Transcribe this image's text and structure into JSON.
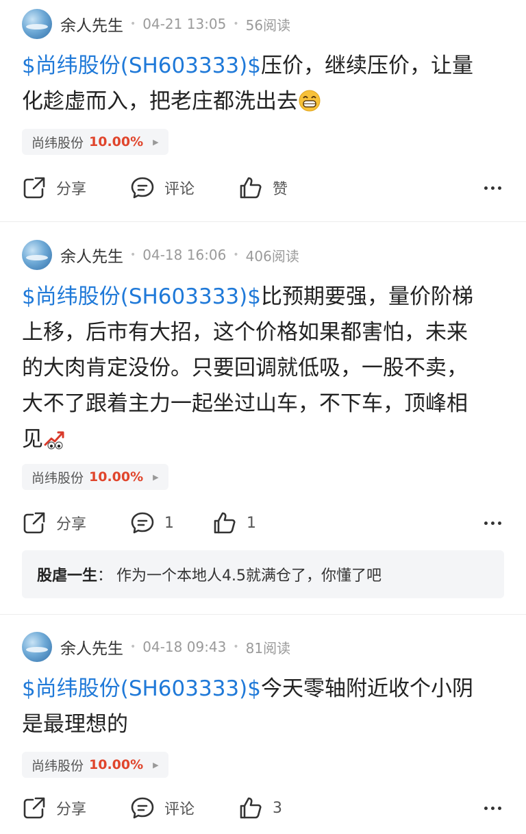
{
  "posts": [
    {
      "author": "余人先生",
      "time": "04-21 13:05",
      "reads": "56阅读",
      "stock_link": "$尚纬股份(SH603333)$",
      "lines": [
        "压价，继续压价，让量",
        "化趁虚而入，把老庄都洗出去"
      ],
      "emoji": "grin-emoji",
      "tag_name": "尚纬股份",
      "tag_pct": "10.00%",
      "share": "分享",
      "comment": "评论",
      "like": "赞"
    },
    {
      "author": "余人先生",
      "time": "04-18 16:06",
      "reads": "406阅读",
      "stock_link": "$尚纬股份(SH603333)$",
      "lines": [
        "比预期要强，量价阶梯",
        "上移，后市有大招，这个价格如果都害怕，未来",
        "的大肉肯定没份。只要回调就低吸，一股不卖，",
        "大不了跟着主力一起坐过山车，不下车，顶峰相",
        "见"
      ],
      "emoji": "chart-up-eyes-emoji",
      "tag_name": "尚纬股份",
      "tag_pct": "10.00%",
      "share": "分享",
      "comment": "1",
      "like": "1",
      "reply": {
        "user": "股虐一生",
        "sep": "：",
        "text": "作为一个本地人4.5就满仓了，你懂了吧"
      }
    },
    {
      "author": "余人先生",
      "time": "04-18 09:43",
      "reads": "81阅读",
      "stock_link": "$尚纬股份(SH603333)$",
      "lines": [
        "今天零轴附近收个小阴",
        "是最理想的"
      ],
      "tag_name": "尚纬股份",
      "tag_pct": "10.00%",
      "share": "分享",
      "comment": "评论",
      "like": "3"
    }
  ],
  "colors": {
    "link": "#1f79d8",
    "up": "#e0452c",
    "meta": "#9a9a9a"
  }
}
